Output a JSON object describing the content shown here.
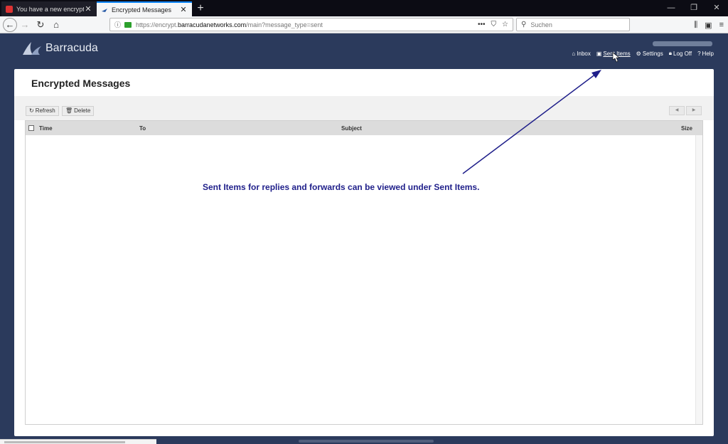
{
  "browser": {
    "tabs": [
      {
        "title": "You have a new encrypted me..."
      },
      {
        "title": "Encrypted Messages"
      }
    ],
    "url_prefix": "https://encrypt.",
    "url_domain": "barracudanetworks.com",
    "url_path": "/main?message_type=sent",
    "search_placeholder": "Suchen"
  },
  "app": {
    "logo_text": "Barracuda",
    "nav": [
      {
        "label": "Inbox",
        "icon": "home-icon"
      },
      {
        "label": "Sent Items",
        "icon": "sent-icon"
      },
      {
        "label": "Settings",
        "icon": "gear-icon"
      },
      {
        "label": "Log Off",
        "icon": "lock-icon"
      },
      {
        "label": "Help",
        "icon": "help-icon"
      }
    ],
    "current_nav": "Sent Items"
  },
  "main": {
    "title": "Encrypted Messages",
    "buttons": {
      "refresh": "Refresh",
      "delete": "Delete"
    },
    "columns": [
      "Time",
      "To",
      "Subject",
      "Size"
    ]
  },
  "annotation": {
    "text": "Sent Items for replies and forwards can be viewed under Sent Items."
  },
  "colors": {
    "header_bg": "#2b3a5c",
    "annotation": "#1f1f8a"
  }
}
